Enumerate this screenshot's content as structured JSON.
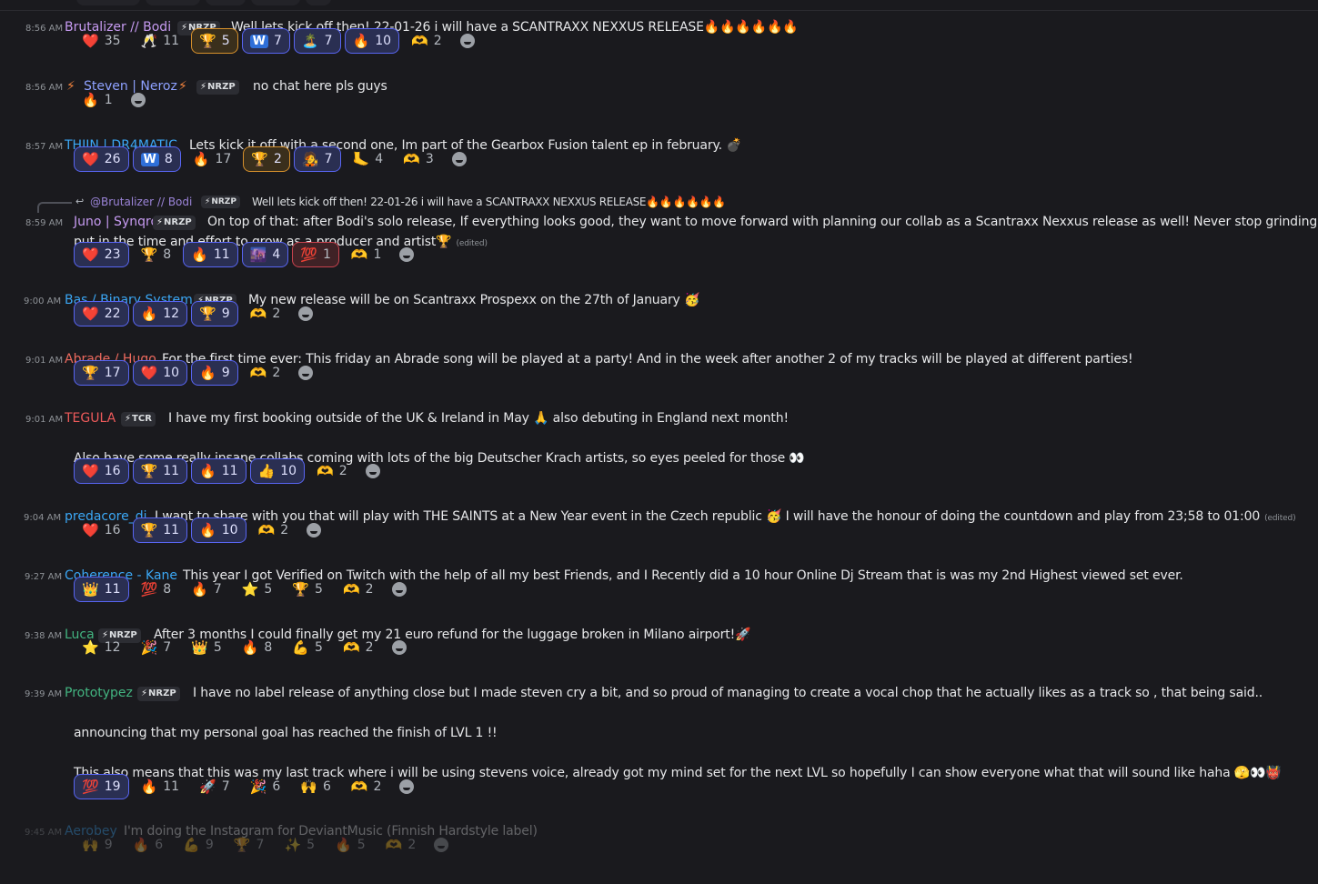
{
  "colors": {
    "background": "#1a1a1e",
    "reaction_selected_border": "#5865f2",
    "timestamp": "#8e9297"
  },
  "icons": {
    "add_reaction": "smile-add-reaction-icon",
    "reply_arrow": "reply-arrow-icon",
    "tag_bolt": "lightning-bolt-icon"
  },
  "messages": [
    {
      "time": "8:56 AM",
      "author": "Brutalizer // Bodi",
      "author_color": "#c79bf2",
      "tag": "NRZP",
      "lines": [
        "Well lets kick off then! 22-01-26 i will have a SCANTRAXX NEXXUS RELEASE🔥🔥🔥🔥🔥🔥"
      ],
      "reactions": [
        {
          "emoji": "❤️",
          "count": "35"
        },
        {
          "emoji": "🥂",
          "count": "11"
        },
        {
          "emoji": "🏆",
          "count": "5",
          "me": true,
          "gold": true
        },
        {
          "emoji": "W",
          "count": "7",
          "me": true
        },
        {
          "emoji": "🏝️",
          "count": "7",
          "me": true
        },
        {
          "emoji": "🔥",
          "count": "10",
          "me": true
        },
        {
          "emoji": "🫶",
          "count": "2"
        }
      ]
    },
    {
      "time": "8:56 AM",
      "author": "Steven | Neroz",
      "author_color": "#8ea1ff",
      "pre": "⚡",
      "post": "⚡",
      "tag": "NRZP",
      "lines": [
        "no chat here pls guys"
      ],
      "reactions": [
        {
          "emoji": "🔥",
          "count": "1"
        }
      ]
    },
    {
      "time": "8:57 AM",
      "author": "THIJN | DR4MATIC",
      "author_color": "#3ba7f5",
      "lines": [
        "Lets kick it off with a second one, Im part of the Gearbox Fusion talent ep in february. 💣"
      ],
      "reactions": [
        {
          "emoji": "❤️",
          "count": "26",
          "me": true
        },
        {
          "emoji": "W",
          "count": "8",
          "me": true
        },
        {
          "emoji": "🔥",
          "count": "17"
        },
        {
          "emoji": "🏆",
          "count": "2",
          "me": true,
          "gold": true
        },
        {
          "emoji": "🧑‍🎤",
          "count": "7",
          "me": true
        },
        {
          "emoji": "🦶",
          "count": "4"
        },
        {
          "emoji": "🫶",
          "count": "3"
        }
      ]
    },
    {
      "time": "8:59 AM",
      "author": "Juno | Synqro",
      "author_color": "#c79bf2",
      "tag": "NRZP",
      "reply": {
        "author": "@Brutalizer // Bodi",
        "tag": "NRZP",
        "text": "Well lets kick off then! 22-01-26 i will have a SCANTRAXX NEXXUS RELEASE🔥🔥🔥🔥🔥🔥"
      },
      "lines": [
        "On top of that: after Bodi's solo release, If everything looks good, they want to move forward with planning our collab as a Scantraxx Nexxus release as well! Never stop grinding guys.",
        "put in the time and effort to grow as a producer and artist🏆"
      ],
      "edited": "(edited)",
      "reactions": [
        {
          "emoji": "❤️",
          "count": "23",
          "me": true
        },
        {
          "emoji": "🏆",
          "count": "8"
        },
        {
          "emoji": "🔥",
          "count": "11",
          "me": true
        },
        {
          "emoji": "🌆",
          "count": "4",
          "me": true
        },
        {
          "emoji": "💯",
          "count": "1",
          "red": true
        },
        {
          "emoji": "🫶",
          "count": "1"
        }
      ]
    },
    {
      "time": "9:00 AM",
      "author": "Bas / Binary System",
      "author_color": "#3ba7f5",
      "tag": "NRZP",
      "lines": [
        "My new release will be on Scantraxx Prospexx on the 27th of January 🥳"
      ],
      "reactions": [
        {
          "emoji": "❤️",
          "count": "22",
          "me": true
        },
        {
          "emoji": "🔥",
          "count": "12",
          "me": true
        },
        {
          "emoji": "🏆",
          "count": "9",
          "me": true
        },
        {
          "emoji": "🫶",
          "count": "2"
        }
      ]
    },
    {
      "time": "9:01 AM",
      "author": "Abrade / Hugo",
      "author_color": "#ed6a5e",
      "lines": [
        "For the first time ever: This friday an Abrade song will be played at a party! And in the week after another 2 of my tracks will be played at different parties!"
      ],
      "reactions": [
        {
          "emoji": "🏆",
          "count": "17",
          "me": true
        },
        {
          "emoji": "❤️",
          "count": "10",
          "me": true
        },
        {
          "emoji": "🔥",
          "count": "9",
          "me": true
        },
        {
          "emoji": "🫶",
          "count": "2"
        }
      ]
    },
    {
      "time": "9:01 AM",
      "author": "TEGULA",
      "author_color": "#ed5a5a",
      "tag": "TCR",
      "lines": [
        "I have my first booking outside of the UK & Ireland in May 🙏 also debuting in England next month!",
        "",
        "Also have some really insane collabs coming with lots of the big Deutscher Krach artists, so eyes peeled for those 👀"
      ],
      "reactions": [
        {
          "emoji": "❤️",
          "count": "16",
          "me": true
        },
        {
          "emoji": "🏆",
          "count": "11",
          "me": true
        },
        {
          "emoji": "🔥",
          "count": "11",
          "me": true
        },
        {
          "emoji": "👍",
          "count": "10",
          "me": true
        },
        {
          "emoji": "🫶",
          "count": "2"
        }
      ]
    },
    {
      "time": "9:04 AM",
      "author": "predacore_dj",
      "author_color": "#3ba7f5",
      "lines": [
        "I want to share with you that will play with THE SAINTS at a New Year event in the Czech republic 🥳 I will have the honour of doing the countdown and play from 23;58 to 01:00"
      ],
      "edited": "(edited)",
      "reactions": [
        {
          "emoji": "❤️",
          "count": "16"
        },
        {
          "emoji": "🏆",
          "count": "11",
          "me": true
        },
        {
          "emoji": "🔥",
          "count": "10",
          "me": true
        },
        {
          "emoji": "🫶",
          "count": "2"
        }
      ]
    },
    {
      "time": "9:27 AM",
      "author": "Coherence - Kane",
      "author_color": "#3ba7f5",
      "lines": [
        "This year I got Verified on Twitch with the help of all my best Friends, and I Recently did a 10 hour Online Dj Stream that is was my 2nd Highest viewed set ever."
      ],
      "reactions": [
        {
          "emoji": "👑",
          "count": "11",
          "me": true
        },
        {
          "emoji": "💯",
          "count": "8"
        },
        {
          "emoji": "🔥",
          "count": "7"
        },
        {
          "emoji": "⭐",
          "count": "5"
        },
        {
          "emoji": "🏆",
          "count": "5"
        },
        {
          "emoji": "🫶",
          "count": "2"
        }
      ]
    },
    {
      "time": "9:38 AM",
      "author": "Luca",
      "author_color": "#43b581",
      "tag": "NRZP",
      "lines": [
        "After 3 months I could finally get my 21 euro refund for the luggage broken in Milano airport!🚀"
      ],
      "reactions": [
        {
          "emoji": "⭐",
          "count": "12"
        },
        {
          "emoji": "🎉",
          "count": "7"
        },
        {
          "emoji": "👑",
          "count": "5"
        },
        {
          "emoji": "🔥",
          "count": "8"
        },
        {
          "emoji": "💪",
          "count": "5"
        },
        {
          "emoji": "🫶",
          "count": "2"
        }
      ]
    },
    {
      "time": "9:39 AM",
      "author": "Prototypez",
      "author_color": "#43b581",
      "tag": "NRZP",
      "lines": [
        "I have no label release of anything close but I made steven cry a bit, and so proud of managing to create a vocal chop that he actually likes as a track so , that being said..",
        "",
        "announcing that my personal goal has reached the finish of LVL 1 !!",
        "",
        "This also means that this was my last track where i will be using stevens voice, already got my mind set for the next LVL so hopefully I can show everyone what that will sound like haha 🫣👀👹"
      ],
      "reactions": [
        {
          "emoji": "💯",
          "count": "19",
          "me": true
        },
        {
          "emoji": "🔥",
          "count": "11"
        },
        {
          "emoji": "🚀",
          "count": "7"
        },
        {
          "emoji": "🎉",
          "count": "6"
        },
        {
          "emoji": "🙌",
          "count": "6"
        },
        {
          "emoji": "🫶",
          "count": "2"
        }
      ]
    },
    {
      "time": "9:45 AM",
      "author": "Aerobey",
      "author_color": "#3ba7f5",
      "lines": [
        "I'm doing the Instagram for DeviantMusic (Finnish Hardstyle label)"
      ],
      "reactions": [
        {
          "emoji": "🙌",
          "count": "9"
        },
        {
          "emoji": "🔥",
          "count": "6"
        },
        {
          "emoji": "💪",
          "count": "9"
        },
        {
          "emoji": "🏆",
          "count": "7"
        },
        {
          "emoji": "✨",
          "count": "5"
        },
        {
          "emoji": "🔥",
          "count": "5"
        },
        {
          "emoji": "🫶",
          "count": "2"
        }
      ]
    }
  ]
}
